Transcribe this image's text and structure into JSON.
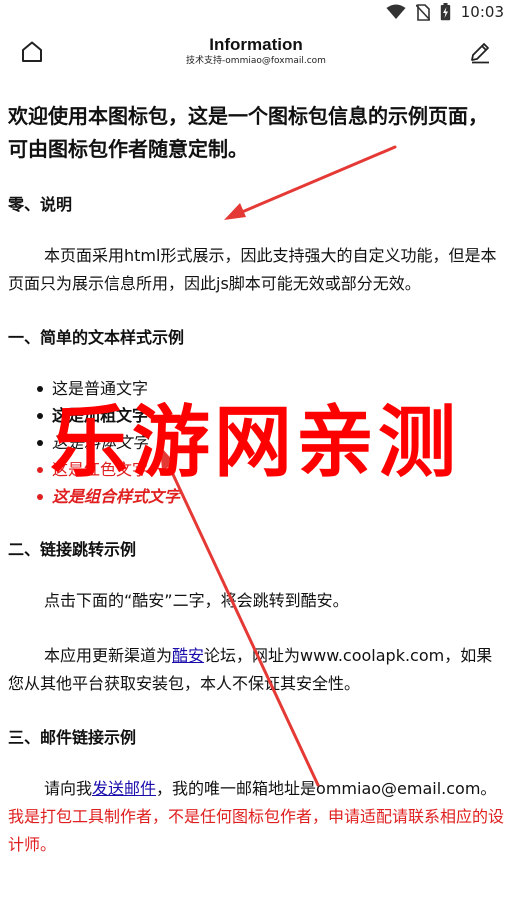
{
  "status_bar": {
    "time": "10:03",
    "icons": [
      "wifi-icon",
      "no-sim-icon",
      "battery-charging-icon"
    ]
  },
  "app_bar": {
    "title": "Information",
    "subtitle": "技术支持-ommiao@foxmail.com",
    "left_icon": "home-icon",
    "right_icon": "edit-icon"
  },
  "content": {
    "intro": "欢迎使用本图标包，这是一个图标包信息的示例页面，可由图标包作者随意定制。",
    "sec0": {
      "heading": "零、说明",
      "para": "本页面采用html形式展示，因此支持强大的自定义功能，但是本页面只为展示信息所用，因此js脚本可能无效或部分无效。"
    },
    "sec1": {
      "heading": "一、简单的文本样式示例",
      "items": [
        "这是普通文字",
        "这是加粗文字",
        "这是斜体文字",
        "这是红色文字",
        "这是组合样式文字"
      ]
    },
    "sec2": {
      "heading": "二、链接跳转示例",
      "para1": "点击下面的“酷安”二字，将会跳转到酷安。",
      "para2_pre": "本应用更新渠道为",
      "para2_link": "酷安",
      "para2_post": "论坛，网址为www.coolapk.com，如果您从其他平台获取安装包，本人不保证其安全性。"
    },
    "sec3": {
      "heading": "三、邮件链接示例",
      "para_pre": "请向我",
      "para_link": "发送邮件",
      "para_mid": "，我的唯一邮箱地址是ommiao@email.com。",
      "para_red": "我是打包工具制作者，不是任何图标包作者，申请适配请联系相应的设计师。"
    }
  },
  "watermark": "乐游网亲测",
  "colors": {
    "red_text": "#e02020",
    "link": "#1a0dab",
    "watermark": "#ff0000",
    "arrow": "#e53935"
  }
}
